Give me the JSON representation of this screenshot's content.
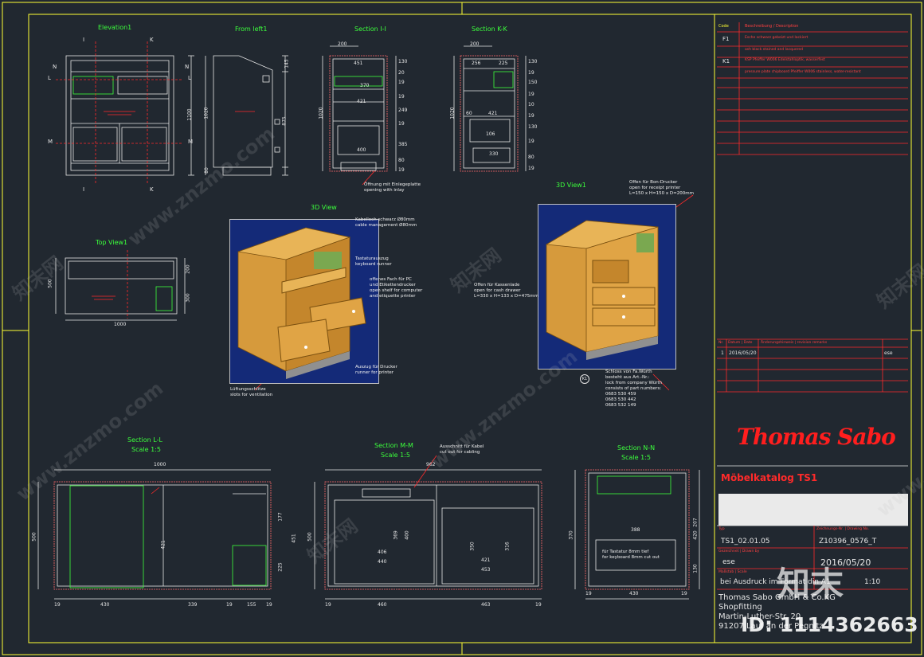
{
  "views": {
    "elevation1": "Elevation1",
    "front_left1": "From left1",
    "section_ii": "Section I-I",
    "section_kk": "Section K-K",
    "view3d_left": "3D View",
    "view3d_right": "3D View1",
    "top_view1": "Top View1",
    "section_ll": "Section L-L",
    "section_mm": "Section M-M",
    "section_nn": "Section N-N",
    "scale": "Scale 1:5",
    "k1_marker": "K1"
  },
  "markers": {
    "i": "I",
    "k": "K",
    "n": "N",
    "l": "L",
    "m": "M"
  },
  "dims": {
    "elev_1100": "1100",
    "left_1020": "1020",
    "left_875": "875",
    "left_145": "145",
    "left_80": "80",
    "ii_200": "200",
    "ii_451": "451",
    "ii_370": "370",
    "ii_421": "421",
    "ii_400": "400",
    "ii_1020": "1020",
    "ii_r": [
      "130",
      "20",
      "19",
      "19",
      "249",
      "19",
      "385",
      "80",
      "19"
    ],
    "kk_200": "200",
    "kk_256": "256",
    "kk_225": "225",
    "kk_421": "421",
    "kk_60": "60",
    "kk_106": "106",
    "kk_330": "330",
    "kk_1020": "1020",
    "kk_r": [
      "130",
      "19",
      "150",
      "19",
      "10",
      "19",
      "130",
      "19",
      "80",
      "19"
    ],
    "top_500": "500",
    "top_200": "200",
    "top_300": "300",
    "top_1000": "1000",
    "ll_1000": "1000",
    "ll_500": "500",
    "ll_421": "421",
    "ll_177": "177",
    "ll_451": "451",
    "ll_225": "225",
    "ll_bottom": [
      "19",
      "430",
      "339",
      "19",
      "155",
      "19"
    ],
    "mm_962": "962",
    "mm_500": "500",
    "mm_406": "406",
    "mm_440": "440",
    "mm_369": "369",
    "mm_400": "400",
    "mm_350": "350",
    "mm_421": "421",
    "mm_316": "316",
    "mm_453": "453",
    "mm_bottom": [
      "19",
      "460",
      "463",
      "19"
    ],
    "nn_388": "388",
    "nn_370": "370",
    "nn_420": "420",
    "nn_207": "207",
    "nn_130": "130",
    "nn_bottom": [
      "19",
      "430",
      "19"
    ]
  },
  "notes": {
    "ii_opening": "Öffnung mit Einlegeplatte\nopening with inlay",
    "cable": "Kabelloch schwarz Ø80mm\ncable management Ø80mm",
    "keyboard": "Tastaturauszug\nkeyboard runner",
    "open_shelf": "offenes Fach für PC\nund Etikettendrucker\nopen shelf for computer\nand etiquette printer",
    "printer_runner": "Auszug für Drucker\nrunner for printer",
    "ventilation": "Lüftungsschlitze\nslots for ventilation",
    "bon_printer": "Offen für Bon-Drucker\nopen for receipt printer\nL=150 x H=150 x D=200mm",
    "cash_drawer": "Offen für Kassenlade\nopen for cash drawer\nL=330 x H=133 x D=475mm",
    "lock": "Schloss von Fa.Würth\nbesteht aus Art.-Nr.:\nlock from company Würth\nconsists of part numbers:\n0683 530 459\n0683 530 442\n0683 532 149",
    "cable_cutout": "Ausschnitt für Kabel\ncut out for cabling",
    "keyboard_cut": "für Tastatur 8mm tief\nfor keyboard 8mm cut out"
  },
  "legend": {
    "header_code": "Code",
    "header_desc": "Beschreibung / Description",
    "rows": [
      {
        "code": "F1",
        "de": "Esche schwarz gebeizt und lackiert",
        "en": "ash black stained and lacquered"
      },
      {
        "code": "K1",
        "de": "KSP Pfeiffer W006 Edelstahloptik, wasserfest",
        "en": "pressure plate chipboard Pfeiffer W006 stainless, water-resistant"
      }
    ]
  },
  "revision": {
    "headers": [
      "Nr.",
      "Datum | Date",
      "Änderungshinweis | revision remarks",
      ""
    ],
    "row": {
      "nr": "1",
      "date": "2016/05/20",
      "remark": "",
      "by": "ese"
    }
  },
  "brand": "Thomas Sabo",
  "title_block": {
    "catalog": "Möbelkatalog TS1",
    "type_label": "Typ",
    "type": "TS1_02.01.05",
    "drawing_label": "Zeichnungs-Nr. | Drawing No.",
    "drawing_no": "Z10396_0576_T",
    "drawn_label": "Gezeichnet | Drawn by",
    "drawn_by": "ese",
    "date": "2016/05/20",
    "scale_label": "Maßstab | Scale",
    "scale_note": "bei Ausdruck im Format din A1",
    "scale_value": "1:10",
    "company": "Thomas Sabo GmbH & Co.KG",
    "dept": "Shopfitting",
    "street": "Martin-Luther-Str. 20",
    "city": "91207 Lauf an der Pegnitz"
  },
  "watermark": {
    "brand_cn": "知末",
    "id_line": "ID: 1114362663",
    "site": "www.znzmo.com",
    "site_cn": "知末网"
  },
  "colors": {
    "background": "#212830",
    "border": "#ffff33",
    "linework": "#e6e6e6",
    "accent_red": "#ff2a2a",
    "accent_green": "#3cff3c",
    "wood": "#d69a3c",
    "view3d_bg": "#142a78"
  }
}
